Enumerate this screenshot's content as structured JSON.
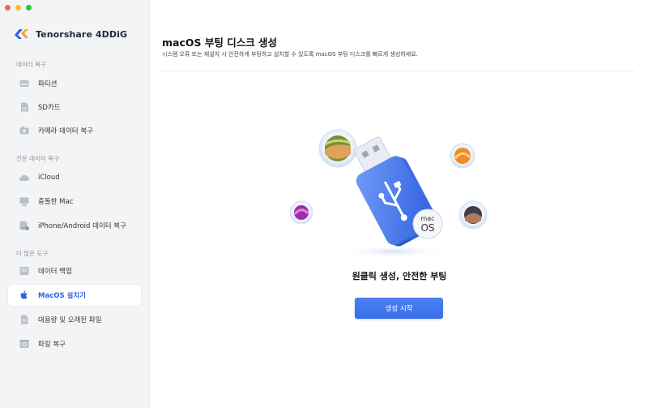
{
  "app": {
    "name": "Tenorshare 4DDiG"
  },
  "sidebar": {
    "sections": [
      {
        "title": "데이터 복구"
      },
      {
        "title": "전문 데이터 복구"
      },
      {
        "title": "더 많은 도구"
      }
    ],
    "items": [
      {
        "label": "파티션",
        "icon": "partition-icon"
      },
      {
        "label": "SD카드",
        "icon": "sd-card-icon"
      },
      {
        "label": "카메라 데이터 복구",
        "icon": "camera-icon"
      },
      {
        "label": "iCloud",
        "icon": "cloud-icon"
      },
      {
        "label": "충돌한 Mac",
        "icon": "crashed-mac-icon"
      },
      {
        "label": "iPhone/Android 데이터 복구",
        "icon": "phone-recovery-icon"
      },
      {
        "label": "데이터 백업",
        "icon": "backup-icon"
      },
      {
        "label": "MacOS 설치기",
        "icon": "apple-icon",
        "active": true
      },
      {
        "label": "대용량 및 오래된 파일",
        "icon": "large-files-icon"
      },
      {
        "label": "파일 복구",
        "icon": "file-repair-icon"
      }
    ]
  },
  "main": {
    "title": "macOS 부팅 디스크 생성",
    "subtitle": "시스템 오류 또는 재설치 시 안전하게 부팅하고 설치할 수 있도록 macOS 부팅 디스크를 빠르게 생성하세요.",
    "usb_badge_line1": "mac",
    "usb_badge_line2": "OS",
    "headline": "원클릭 생성, 안전한 부팅",
    "start_button": "생성 시작"
  },
  "colors": {
    "accent": "#3a6ee6",
    "sidebar_bg": "#f3f4f6"
  }
}
